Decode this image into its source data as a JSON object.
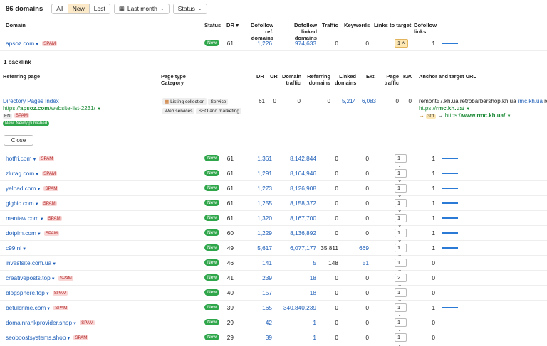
{
  "header": {
    "count_label": "86 domains",
    "filters": [
      "All",
      "New",
      "Lost"
    ],
    "active_filter": "New",
    "period": "Last month",
    "status": "Status"
  },
  "columns": {
    "domain": "Domain",
    "status": "Status",
    "dr": "DR",
    "dofollow_ref": "Dofollow ref. domains",
    "dofollow_linked": "Dofollow linked domains",
    "traffic": "Traffic",
    "keywords": "Keywords",
    "links_to_target": "Links to target",
    "dofollow_links": "Dofollow links"
  },
  "first_row": {
    "domain": "apsoz.com",
    "spam": "SPAM",
    "status": "New",
    "dr": "61",
    "ref": "1,226",
    "linked": "974,633",
    "traffic": "0",
    "keywords": "0",
    "links": "1",
    "dofollow": "1"
  },
  "panel": {
    "title": "1 backlink",
    "columns": {
      "referring_page": "Referring page",
      "page_type": "Page type",
      "category": "Category",
      "dr": "DR",
      "ur": "UR",
      "domain_traffic": "Domain traffic",
      "referring_domains": "Referring domains",
      "linked_domains": "Linked domains",
      "ext": "Ext.",
      "page_traffic": "Page traffic",
      "kw": "Kw.",
      "anchor": "Anchor and target URL"
    },
    "page_title": "Directory Pages Index",
    "page_url_prefix": "https://",
    "page_url_domain": "apsoz.com",
    "page_url_rest": "/website-list-2231/",
    "lang": "EN",
    "spam": "SPAM",
    "new_label": "New: Newly published",
    "tags": [
      "Listing collection",
      "Service",
      "Web services",
      "SEO and marketing",
      "..."
    ],
    "dr": "61",
    "ur": "0",
    "domain_traffic": "0",
    "referring_domains": "0",
    "linked_domains": "5,214",
    "ext": "6,083",
    "page_traffic": "0",
    "kw": "0",
    "anchor_text": "remont57.kh.ua retrobarbershop.kh.ua",
    "anchor_link": "rmc.kh.ua",
    "anchor_tail": "roi",
    "target_prefix": "https://",
    "target_domain": "rmc.kh.ua/",
    "redirect_code": "301",
    "redirect_prefix": "https://",
    "redirect_domain": "www.rmc.kh.ua/",
    "close_label": "Close"
  },
  "rows": [
    {
      "domain": "hotfri.com",
      "spam": true,
      "status": "New",
      "dr": "61",
      "ref": "1,361",
      "linked": "8,142,844",
      "traffic": "0",
      "keywords": "0",
      "links": "1",
      "dofollow": "1",
      "bar": true
    },
    {
      "domain": "zlutag.com",
      "spam": true,
      "status": "New",
      "dr": "61",
      "ref": "1,291",
      "linked": "8,164,946",
      "traffic": "0",
      "keywords": "0",
      "links": "1",
      "dofollow": "1",
      "bar": true
    },
    {
      "domain": "yelpad.com",
      "spam": true,
      "status": "New",
      "dr": "61",
      "ref": "1,273",
      "linked": "8,126,908",
      "traffic": "0",
      "keywords": "0",
      "links": "1",
      "dofollow": "1",
      "bar": true
    },
    {
      "domain": "gigbic.com",
      "spam": true,
      "status": "New",
      "dr": "61",
      "ref": "1,255",
      "linked": "8,158,372",
      "traffic": "0",
      "keywords": "0",
      "links": "1",
      "dofollow": "1",
      "bar": true
    },
    {
      "domain": "mantaw.com",
      "spam": true,
      "status": "New",
      "dr": "61",
      "ref": "1,320",
      "linked": "8,167,700",
      "traffic": "0",
      "keywords": "0",
      "links": "1",
      "dofollow": "1",
      "bar": true
    },
    {
      "domain": "dotpim.com",
      "spam": true,
      "status": "New",
      "dr": "60",
      "ref": "1,229",
      "linked": "8,136,892",
      "traffic": "0",
      "keywords": "0",
      "links": "1",
      "dofollow": "1",
      "bar": true
    },
    {
      "domain": "c99.nl",
      "spam": false,
      "status": "New",
      "dr": "49",
      "ref": "5,617",
      "linked": "6,077,177",
      "traffic": "35,811",
      "keywords": "669",
      "links": "1",
      "dofollow": "1",
      "bar": true,
      "kw_link": true
    },
    {
      "domain": "investsite.com.ua",
      "spam": false,
      "status": "New",
      "dr": "46",
      "ref": "141",
      "linked": "5",
      "traffic": "148",
      "keywords": "51",
      "links": "1",
      "dofollow": "0",
      "bar": false,
      "kw_link": true
    },
    {
      "domain": "creativeposts.top",
      "spam": true,
      "status": "New",
      "dr": "41",
      "ref": "239",
      "linked": "18",
      "traffic": "0",
      "keywords": "0",
      "links": "2",
      "dofollow": "0",
      "bar": false
    },
    {
      "domain": "blogsphere.top",
      "spam": true,
      "status": "New",
      "dr": "40",
      "ref": "157",
      "linked": "18",
      "traffic": "0",
      "keywords": "0",
      "links": "1",
      "dofollow": "0",
      "bar": false
    },
    {
      "domain": "betulcrime.com",
      "spam": true,
      "status": "New",
      "dr": "39",
      "ref": "165",
      "linked": "340,840,239",
      "traffic": "0",
      "keywords": "0",
      "links": "1",
      "dofollow": "1",
      "bar": true
    },
    {
      "domain": "domainrankprovider.shop",
      "spam": true,
      "status": "New",
      "dr": "29",
      "ref": "42",
      "linked": "1",
      "traffic": "0",
      "keywords": "0",
      "links": "1",
      "dofollow": "0",
      "bar": false
    },
    {
      "domain": "seoboostsystems.shop",
      "spam": true,
      "status": "New",
      "dr": "29",
      "ref": "39",
      "linked": "1",
      "traffic": "0",
      "keywords": "0",
      "links": "1",
      "dofollow": "0",
      "bar": false
    }
  ]
}
